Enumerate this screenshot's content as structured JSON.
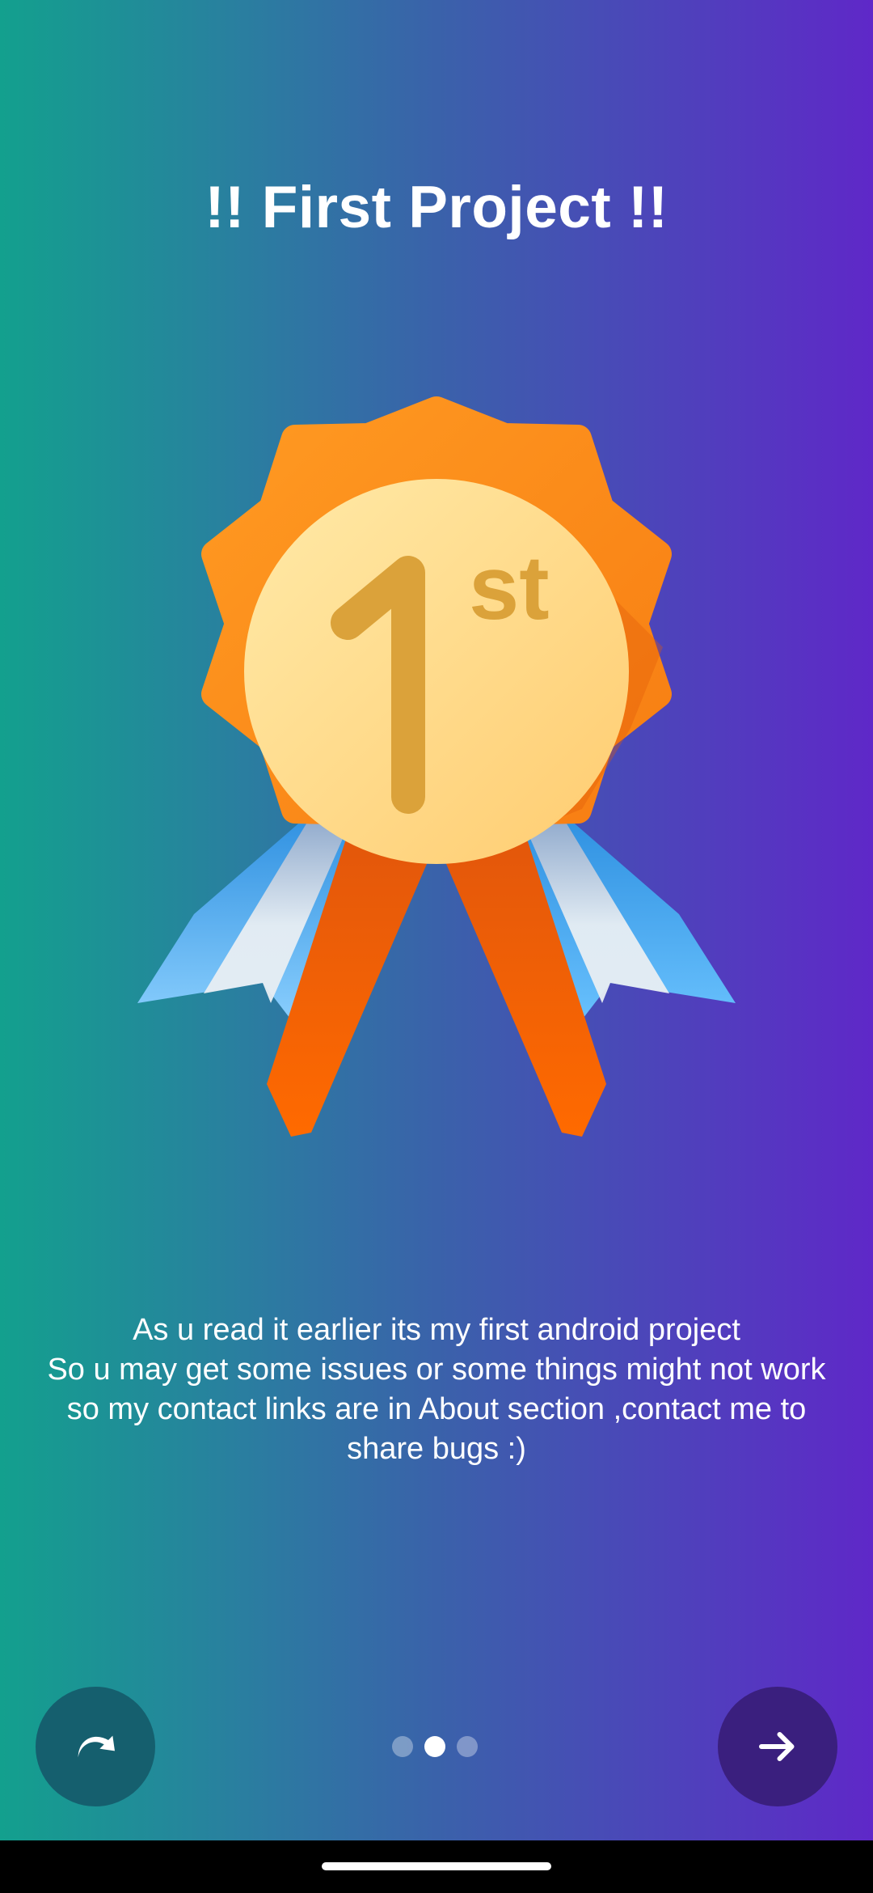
{
  "app": {
    "title": "!! First Project !!"
  },
  "medal": {
    "rank_number": "1",
    "rank_suffix": "st",
    "icon": "first-place-medal"
  },
  "description": {
    "lines": [
      "As u read it earlier its my first android project",
      "So u may get some issues or some things might not work",
      "so my contact links are in About section ,contact me to share bugs :)"
    ]
  },
  "controls": {
    "skip_icon": "skip-redo-icon",
    "next_icon": "arrow-right-icon"
  },
  "pager": {
    "total": 3,
    "current": 2
  },
  "colors": {
    "gradient_start": "#13a08e",
    "gradient_end": "#5f28c8",
    "skip_button": "#155f6e",
    "next_button": "#3a1f7e"
  }
}
